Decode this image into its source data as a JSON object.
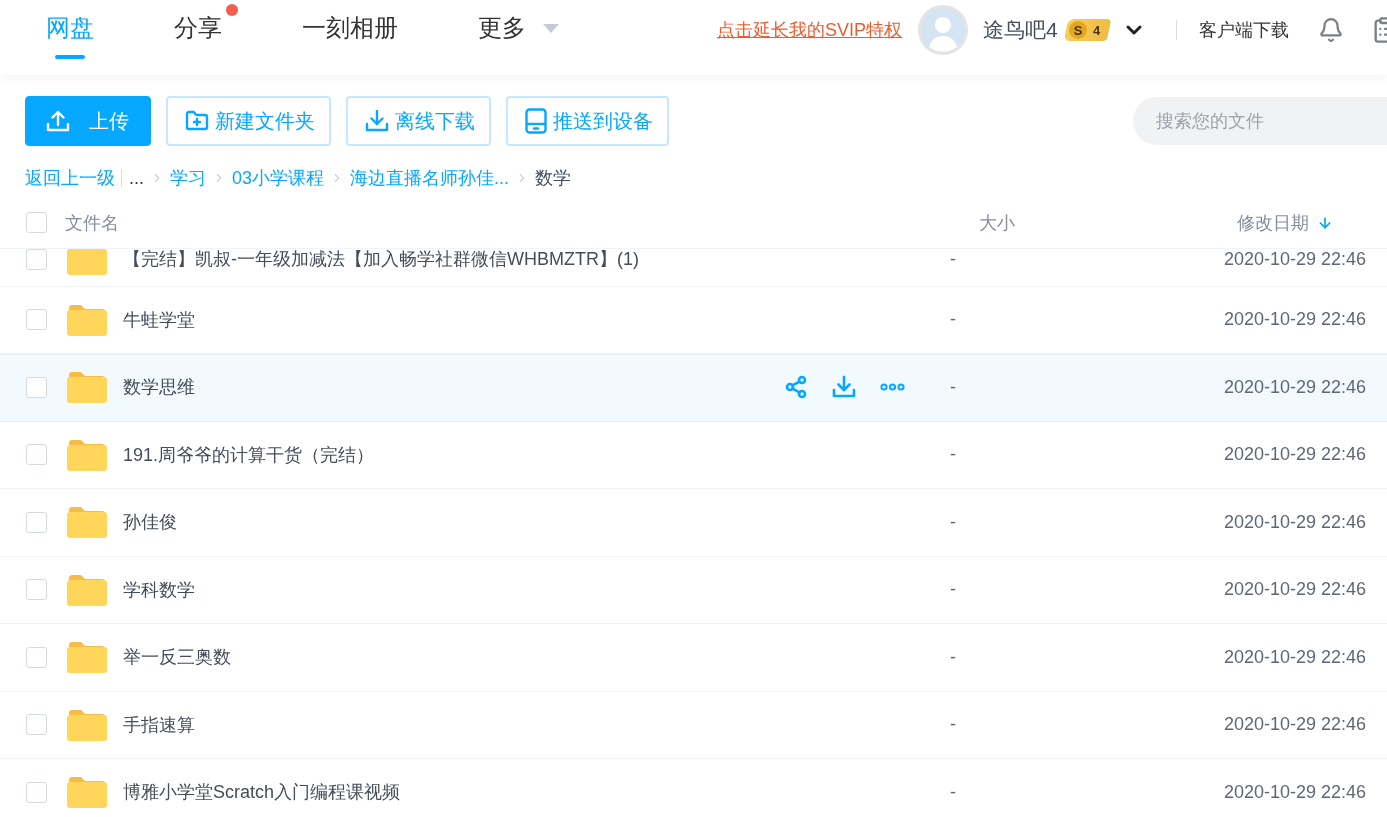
{
  "top_nav": {
    "tabs": [
      {
        "label": "网盘",
        "selected": true,
        "badge": false,
        "dropdown": false
      },
      {
        "label": "分享",
        "selected": false,
        "badge": true,
        "dropdown": false
      },
      {
        "label": "一刻相册",
        "selected": false,
        "badge": false,
        "dropdown": false
      },
      {
        "label": "更多",
        "selected": false,
        "badge": false,
        "dropdown": true
      }
    ],
    "svip_link": "点击延长我的SVIP特权",
    "user": {
      "name": "途鸟吧4",
      "badge_letter": "S",
      "badge_level": "4"
    },
    "client_download": "客户端下载"
  },
  "toolbar": {
    "buttons": [
      {
        "label": "上传",
        "kind": "primary"
      },
      {
        "label": "新建文件夹",
        "kind": "outline"
      },
      {
        "label": "离线下载",
        "kind": "outline"
      },
      {
        "label": "推送到设备",
        "kind": "outline"
      }
    ]
  },
  "search": {
    "placeholder": "搜索您的文件"
  },
  "breadcrumb": {
    "back": "返回上一级",
    "ellipsis": "...",
    "items": [
      {
        "label": "学习",
        "current": false
      },
      {
        "label": "03小学课程",
        "current": false
      },
      {
        "label": "海边直播名师孙佳...",
        "current": false
      },
      {
        "label": "数学",
        "current": true
      }
    ]
  },
  "table": {
    "select_all": {
      "checked": false
    },
    "columns": [
      {
        "label": "文件名",
        "sorted": false
      },
      {
        "label": "大小",
        "sorted": false
      },
      {
        "label": "修改日期",
        "sorted": true
      }
    ],
    "rows": [
      {
        "name": "【完结】凯叔-一年级加减法【加入畅学社群微信WHBMZTR】(1)",
        "size": "-",
        "modified": "2020-10-29 22:46",
        "checked": false,
        "hovered": false
      },
      {
        "name": "牛蛙学堂",
        "size": "-",
        "modified": "2020-10-29 22:46",
        "checked": false,
        "hovered": false
      },
      {
        "name": "数学思维",
        "size": "-",
        "modified": "2020-10-29 22:46",
        "checked": false,
        "hovered": true
      },
      {
        "name": "191.周爷爷的计算干货（完结）",
        "size": "-",
        "modified": "2020-10-29 22:46",
        "checked": false,
        "hovered": false
      },
      {
        "name": "孙佳俊",
        "size": "-",
        "modified": "2020-10-29 22:46",
        "checked": false,
        "hovered": false
      },
      {
        "name": "学科数学",
        "size": "-",
        "modified": "2020-10-29 22:46",
        "checked": false,
        "hovered": false
      },
      {
        "name": "举一反三奥数",
        "size": "-",
        "modified": "2020-10-29 22:46",
        "checked": false,
        "hovered": false
      },
      {
        "name": "手指速算",
        "size": "-",
        "modified": "2020-10-29 22:46",
        "checked": false,
        "hovered": false
      },
      {
        "name": "博雅小学堂Scratch入门编程课视频",
        "size": "-",
        "modified": "2020-10-29 22:46",
        "checked": false,
        "hovered": false
      }
    ]
  }
}
